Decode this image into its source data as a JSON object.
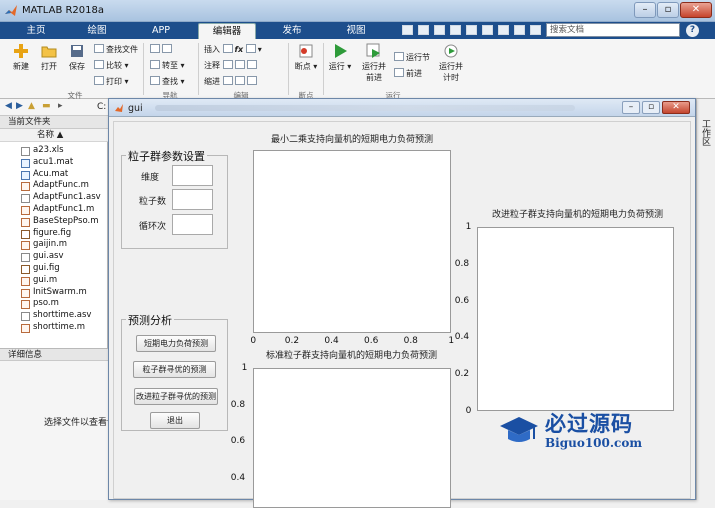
{
  "app": {
    "title": "MATLAB R2018a"
  },
  "ribbon_tabs": [
    "主页",
    "绘图",
    "APP",
    "编辑器",
    "发布",
    "视图"
  ],
  "search": {
    "placeholder": "搜索文档"
  },
  "ribbon": {
    "file_group": {
      "label": "文件",
      "new": "新建",
      "open": "打开",
      "save": "保存",
      "find_files": "查找文件",
      "compare": "比较",
      "print": "打印"
    },
    "nav_group": {
      "label": "导航",
      "goto": "转至",
      "find": "查找"
    },
    "edit_group": {
      "label": "编辑",
      "insert": "插入",
      "comment": "注释",
      "indent": "缩进",
      "fx": "fx"
    },
    "breakpoint_group": {
      "label": "断点",
      "breakpoints": "断点"
    },
    "run_group": {
      "label": "运行",
      "run": "运行",
      "run_advance_1": "运行并",
      "run_advance_2": "前进",
      "run_section": "运行节",
      "advance": "前进",
      "run_time_1": "运行并",
      "run_time_2": "计时"
    }
  },
  "address": {
    "path": "C:"
  },
  "file_panel": {
    "title": "当前文件夹",
    "column_name": "名称 ▲",
    "files": [
      {
        "name": "a23.xls",
        "type": "xls"
      },
      {
        "name": "acu1.mat",
        "type": "mat"
      },
      {
        "name": "Acu.mat",
        "type": "mat"
      },
      {
        "name": "AdaptFunc.m",
        "type": "m"
      },
      {
        "name": "AdaptFunc1.asv",
        "type": "asv"
      },
      {
        "name": "AdaptFunc1.m",
        "type": "m"
      },
      {
        "name": "BaseStepPso.m",
        "type": "m"
      },
      {
        "name": "figure.fig",
        "type": "fig"
      },
      {
        "name": "gaijin.m",
        "type": "m"
      },
      {
        "name": "gui.asv",
        "type": "asv"
      },
      {
        "name": "gui.fig",
        "type": "fig"
      },
      {
        "name": "gui.m",
        "type": "m"
      },
      {
        "name": "InitSwarm.m",
        "type": "m"
      },
      {
        "name": "pso.m",
        "type": "m"
      },
      {
        "name": "shorttime.asv",
        "type": "asv"
      },
      {
        "name": "shorttime.m",
        "type": "m"
      }
    ]
  },
  "detail_panel": {
    "title": "详细信息",
    "hint": "选择文件以查看详"
  },
  "right_strip": {
    "label": "工作区"
  },
  "gui": {
    "title": "gui",
    "pso_panel": {
      "title": "粒子群参数设置",
      "dimension_label": "维度",
      "particles_label": "粒子数",
      "iterations_label": "循环次",
      "dimension_value": "",
      "particles_value": "",
      "iterations_value": ""
    },
    "predict_panel": {
      "title": "预测分析",
      "btn_load_forecast": "短期电力负荷预测",
      "btn_pso_optimize": "粒子群寻优的预测",
      "btn_improved_pso": "改进粒子群寻优的预测",
      "btn_exit": "退出"
    },
    "axes": {
      "lssvm_title": "最小二乘支持向量机的短期电力负荷预测",
      "standard_pso_title": "标准粒子群支持向量机的短期电力负荷预测",
      "improved_pso_title": "改进粒子群支持向量机的短期电力负荷预测"
    }
  },
  "chart_data": [
    {
      "type": "line",
      "title": "最小二乘支持向量机的短期电力负荷预测",
      "series": [],
      "xlim": [
        0,
        1
      ],
      "ylim": [
        0,
        1
      ],
      "x_ticks": [
        "0",
        "0.2",
        "0.4",
        "0.6",
        "0.8",
        "1"
      ]
    },
    {
      "type": "line",
      "title": "标准粒子群支持向量机的短期电力负荷预测",
      "series": [],
      "ylim": [
        0,
        1
      ],
      "y_ticks_visible": [
        "1",
        "0.8",
        "0.6",
        "0.4"
      ]
    },
    {
      "type": "line",
      "title": "改进粒子群支持向量机的短期电力负荷预测",
      "series": [],
      "ylim": [
        0,
        1
      ],
      "y_ticks": [
        "0",
        "0.2",
        "0.4",
        "0.6",
        "0.8",
        "1"
      ]
    }
  ],
  "watermark": {
    "cn": "必过源码",
    "en": "Biguo100.com"
  }
}
